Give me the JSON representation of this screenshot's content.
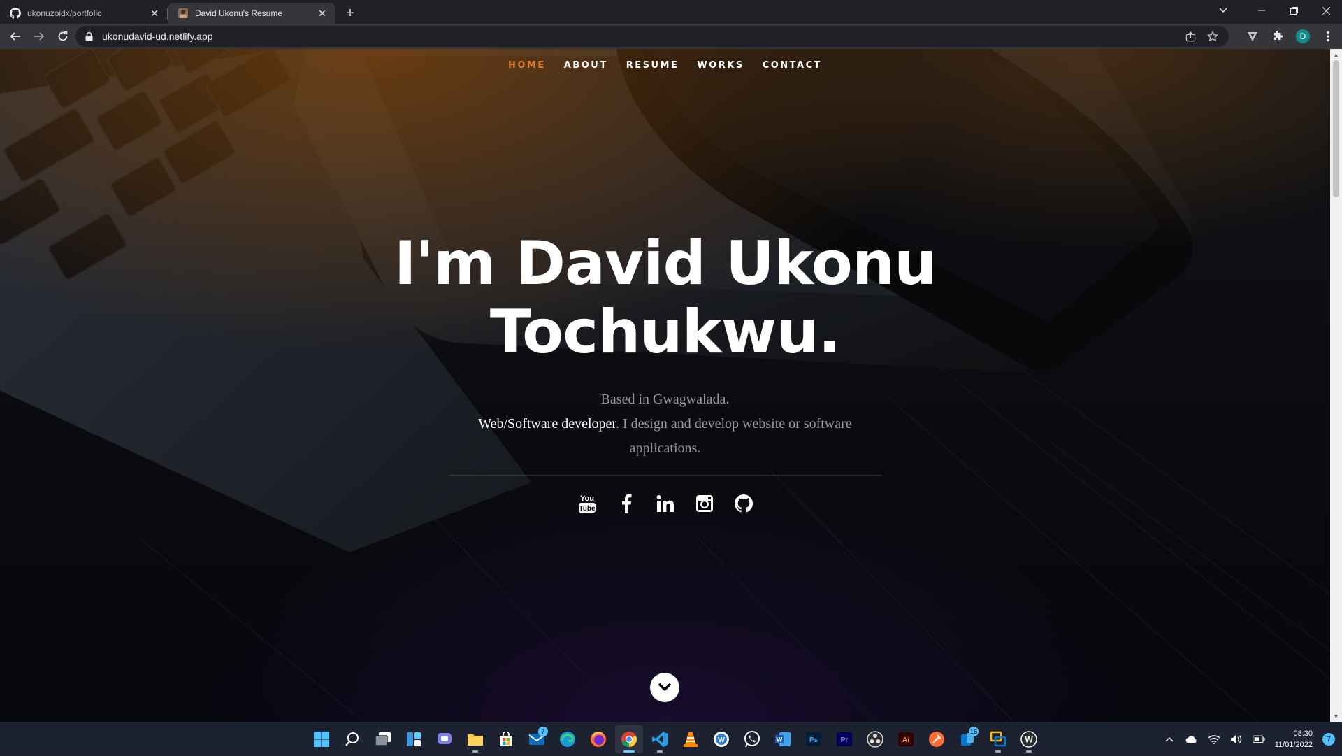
{
  "browser": {
    "tabs": [
      {
        "title": "ukonuzoidx/portfolio",
        "favicon": "github-icon",
        "active": false
      },
      {
        "title": "David Ukonu's Resume",
        "favicon": "portrait-icon",
        "active": true
      }
    ],
    "url": "ukonudavid-ud.netlify.app",
    "profile_initial": "D"
  },
  "site": {
    "nav": [
      "HOME",
      "ABOUT",
      "RESUME",
      "WORKS",
      "CONTACT"
    ],
    "active_nav": "HOME",
    "hero": {
      "line1": "I'm David Ukonu",
      "line2": "Tochukwu.",
      "based": "Based in Gwagwalada.",
      "role": "Web/Software developer",
      "description": ". I design and develop website or software applications."
    },
    "social": [
      "youtube-icon",
      "facebook-icon",
      "linkedin-icon",
      "instagram-icon",
      "github-icon"
    ],
    "accent_color": "#e37b2a"
  },
  "taskbar": {
    "apps": [
      "windows-start-icon",
      "search-icon",
      "task-view-icon",
      "widgets-icon",
      "teams-chat-icon",
      "file-explorer-icon",
      "microsoft-store-icon",
      "mail-icon",
      "edge-icon",
      "firefox-icon",
      "chrome-icon",
      "vscode-icon",
      "vlc-icon",
      "wps-icon",
      "whatsapp-icon",
      "word-icon",
      "photoshop-icon",
      "premiere-icon",
      "obs-icon",
      "illustrator-icon",
      "postman-icon",
      "phone-link-icon",
      "virtual-desktop-icon",
      "wamp-icon"
    ],
    "badges": {
      "mail": "7",
      "phone_link": "16"
    },
    "time": "08:30",
    "date": "11/01/2022",
    "notifications": "7"
  }
}
